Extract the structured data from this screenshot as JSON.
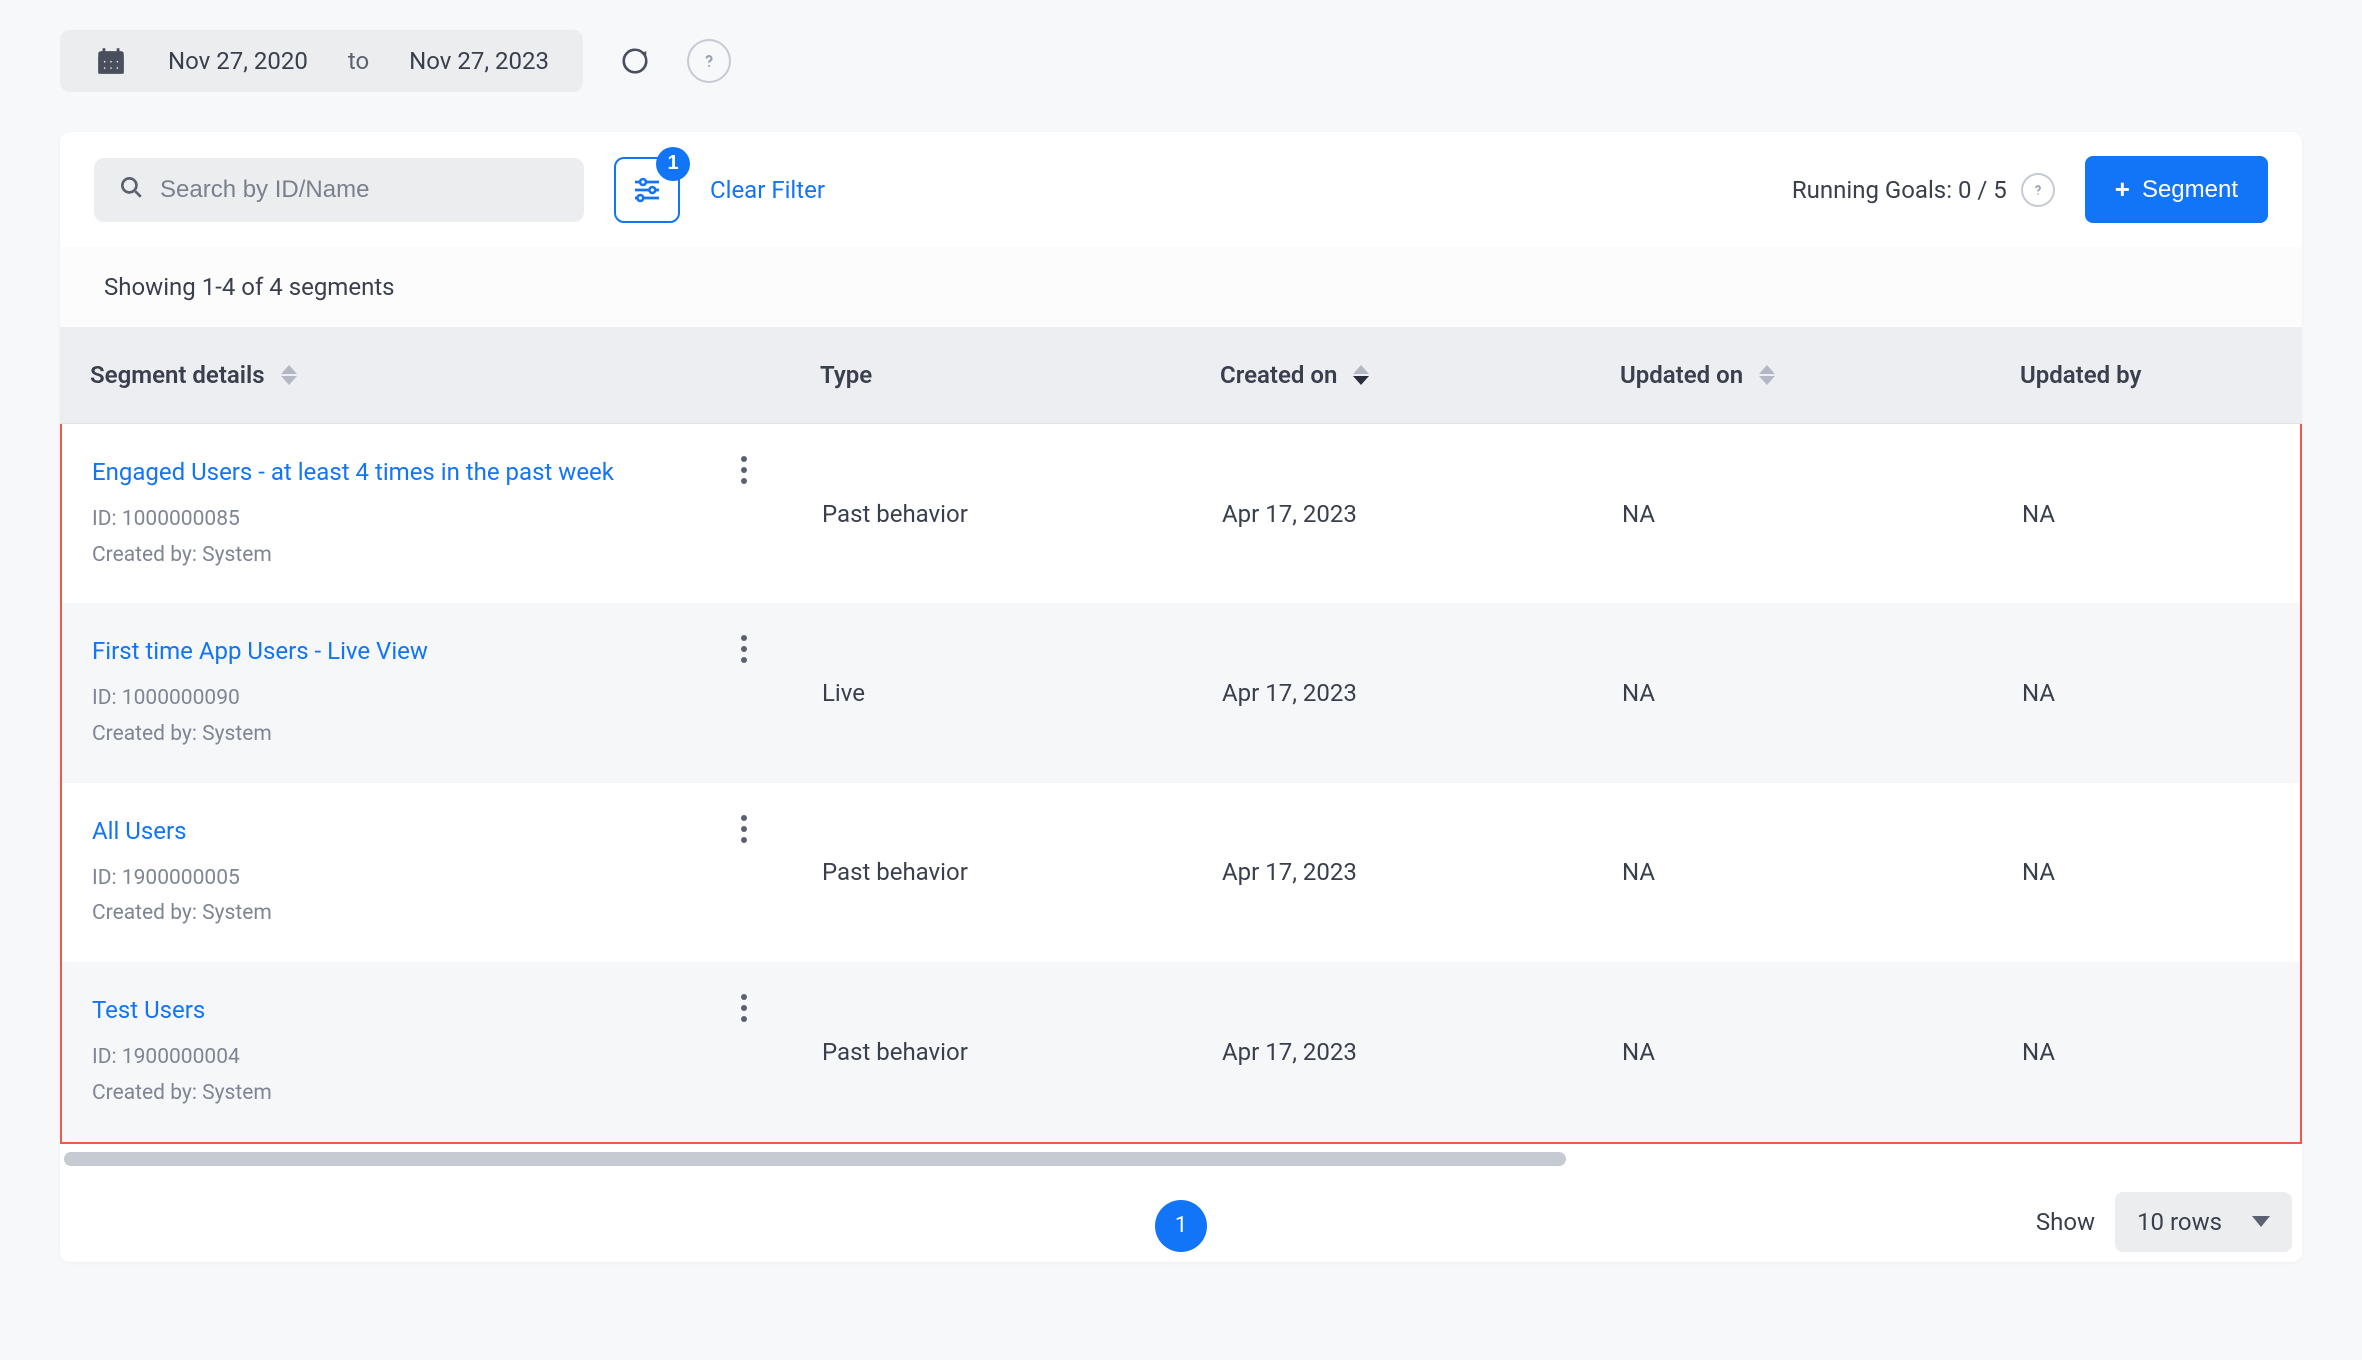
{
  "dateRange": {
    "from": "Nov 27, 2020",
    "sep": "to",
    "to": "Nov 27, 2023"
  },
  "toolbar": {
    "searchPlaceholder": "Search by ID/Name",
    "filterBadge": "1",
    "clearFilter": "Clear Filter",
    "runningGoals": "Running Goals: 0 / 5",
    "newSegment": "Segment"
  },
  "summary": "Showing 1-4 of 4 segments",
  "columns": {
    "details": "Segment details",
    "type": "Type",
    "createdOn": "Created on",
    "updatedOn": "Updated on",
    "updatedBy": "Updated by"
  },
  "rows": [
    {
      "name": "Engaged Users - at least 4 times in the past week",
      "idLabel": "ID: 1000000085",
      "createdByLabel": "Created by: System",
      "type": "Past behavior",
      "createdOn": "Apr 17, 2023",
      "updatedOn": "NA",
      "updatedBy": "NA"
    },
    {
      "name": "First time App Users - Live View",
      "idLabel": "ID: 1000000090",
      "createdByLabel": "Created by: System",
      "type": "Live",
      "createdOn": "Apr 17, 2023",
      "updatedOn": "NA",
      "updatedBy": "NA"
    },
    {
      "name": "All Users",
      "idLabel": "ID: 1900000005",
      "createdByLabel": "Created by: System",
      "type": "Past behavior",
      "createdOn": "Apr 17, 2023",
      "updatedOn": "NA",
      "updatedBy": "NA"
    },
    {
      "name": "Test Users",
      "idLabel": "ID: 1900000004",
      "createdByLabel": "Created by: System",
      "type": "Past behavior",
      "createdOn": "Apr 17, 2023",
      "updatedOn": "NA",
      "updatedBy": "NA"
    }
  ],
  "pagination": {
    "page": "1",
    "showLabel": "Show",
    "rowsLabel": "10 rows"
  }
}
